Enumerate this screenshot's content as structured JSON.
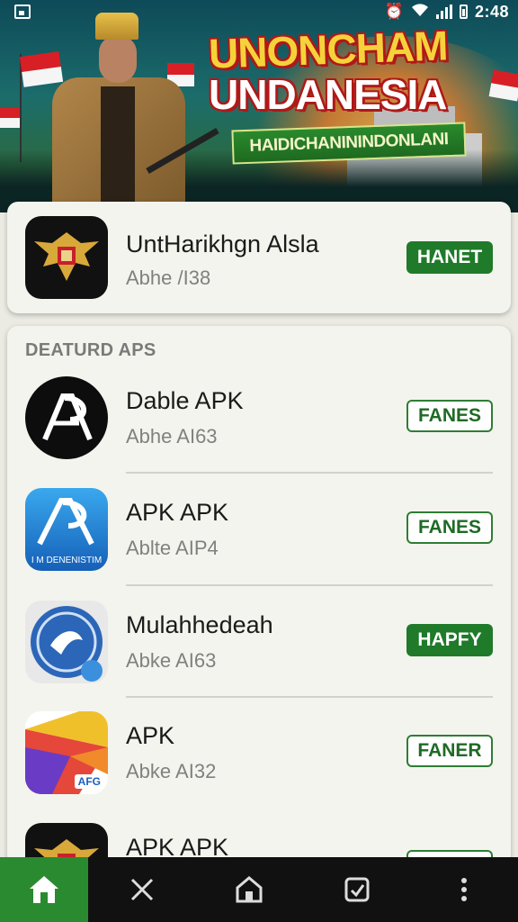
{
  "status_bar": {
    "time": "2:48",
    "icons": [
      "notification-square-icon",
      "alarm-icon",
      "wifi-icon",
      "signal-icon",
      "battery-icon"
    ]
  },
  "banner": {
    "title_line1": "UNONCHAM",
    "title_line2": "UNDANESIA",
    "ribbon_text": "HAIDICHANININDONLANI",
    "colors": {
      "flag_red": "#d81f26",
      "title_yellow": "#f6d23a",
      "ribbon_green": "#1e6a20"
    }
  },
  "featured_top": {
    "name": "UntHarikhgn Alsla",
    "subtitle": "Abhe /I38",
    "button": "HANET",
    "icon": "garuda-emblem-icon"
  },
  "section": {
    "title": "DEATURD APS"
  },
  "apps": [
    {
      "name": "Dable APK",
      "subtitle": "Abhe AI63",
      "button": "FANES",
      "button_style": "outline",
      "icon": "ap-logo-black-icon"
    },
    {
      "name": "APK APK",
      "subtitle": "Ablte AIP4",
      "button": "FANES",
      "button_style": "outline",
      "icon": "ap-logo-blue-icon",
      "icon_caption": "I M DENENISTIM"
    },
    {
      "name": "Mulahhedeah",
      "subtitle": "Abke AI63",
      "button": "HAPFY",
      "button_style": "filled",
      "icon": "blue-seal-icon"
    },
    {
      "name": "APK",
      "subtitle": "Abke AI32",
      "button": "FANER",
      "button_style": "outline",
      "icon": "colorful-fold-icon",
      "icon_caption": "AFG"
    },
    {
      "name": "APK APK",
      "subtitle": "",
      "button": "",
      "button_style": "outline",
      "icon": "garuda-emblem-icon"
    }
  ],
  "nav": [
    {
      "icon": "home-icon",
      "active": true
    },
    {
      "icon": "tools-icon",
      "active": false
    },
    {
      "icon": "house-outline-icon",
      "active": false
    },
    {
      "icon": "checkbox-icon",
      "active": false
    },
    {
      "icon": "more-vertical-icon",
      "active": false
    }
  ],
  "colors": {
    "accent_green": "#1f7a2a",
    "background": "#ebebe4",
    "nav_bg": "#111111"
  }
}
